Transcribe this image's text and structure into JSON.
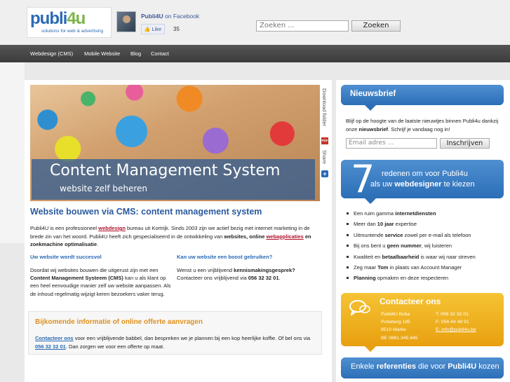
{
  "header": {
    "logo_text_a": "publi",
    "logo_text_b": "4u",
    "logo_tagline": "solutions for web & advertising",
    "fb_name": "Publi4U",
    "fb_on": "on Facebook",
    "fb_like_label": "Like",
    "fb_like_count": "35",
    "search_placeholder": "Zoeken ...",
    "search_button": "Zoeken"
  },
  "nav": {
    "items": [
      "Webdesign (CMS)",
      "Mobile Website",
      "Blog",
      "Contact"
    ]
  },
  "hero": {
    "title": "Content Management System",
    "subtitle": "website zelf beheren"
  },
  "tools": {
    "download": "Download folder",
    "pdf": "PDF",
    "share": "Share"
  },
  "main": {
    "title": "Website bouwen via CMS: content management system",
    "intro_1": "Publi4U is een professioneel ",
    "intro_link1": "webdesign",
    "intro_2": " bureau uit Kortrijk. Sinds 2003 zijn we actief bezig met internet marketing in de brede zin van het woord. Publi4U heeft zich gespecialiseerd in de ontwikkeling van ",
    "intro_b1": "websites, online ",
    "intro_link2": "webapplicaties",
    "intro_3": " en ",
    "intro_b2": "zoekmachine optimalisatie",
    "intro_4": ".",
    "col1_head": "Uw website wordt succesvol",
    "col1_a": "Doordat wij websites bouwen die uitgerust zijn met een ",
    "col1_b": "Content Management Systeem (CMS)",
    "col1_c": " kan u als klant op een heel eenvoudige manier zelf uw website aanpassen. Als de inhoud regelmatig wijzigt keren bezoekers vaker terug.",
    "col2_head": "Kan uw website een boost gebruiken?",
    "col2_a": "Wenst u een vrijblijvend ",
    "col2_b": "kennismakingsgesprek?",
    "col2_c": " Contacteer ons vrijblijvend via ",
    "col2_d": "056 32 32 01",
    "col2_e": "."
  },
  "offer": {
    "title": "Bijkomende informatie of online offerte aanvragen",
    "link": "Contacteer ons",
    "text_1": " voor een vrijblijvende babbel, dan bespreken we je plannen bij een kop heerlijke koffie. Of bel ons via ",
    "phone": "056 32 32 01",
    "text_2": ". Dan zorgen we voor een offerte op maat."
  },
  "newsletter": {
    "title": "Nieuwsbrief",
    "text_1": "Blijf op de hoogte van de laatste nieuwtjes binnen Publi4u dankzij onze ",
    "text_b": "nieuwsbrief",
    "text_2": ". Schrijf je vandaag nog in!",
    "placeholder": "Email adres ...",
    "button": "Inschrijven"
  },
  "reasons": {
    "number": "7",
    "line1": "redenen om voor Publi4u",
    "line2_a": "als uw ",
    "line2_b": "webdesigner",
    "line2_c": " te kiezen",
    "items": [
      {
        "pre": "Een ruim gamma ",
        "bold": "internetdiensten",
        "post": ""
      },
      {
        "pre": "Meer dan ",
        "bold": "10 jaar",
        "post": " expertise"
      },
      {
        "pre": "Uitmuntende ",
        "bold": "service",
        "post": " zowel per e-mail als telefoon"
      },
      {
        "pre": "Bij ons bent u ",
        "bold": "geen nummer",
        "post": ", wij luisteren"
      },
      {
        "pre": "Kwaliteit en ",
        "bold": "betaalbaarheid",
        "post": " is waar wij naar streven"
      },
      {
        "pre": "Zeg maar ",
        "bold": "Tom",
        "post": " in plaats van Account Manager"
      },
      {
        "pre": "",
        "bold": "Planning",
        "post": " opmaken en deze respecteren"
      }
    ]
  },
  "contact": {
    "title": "Contacteer ons",
    "company": "Publi4U Bvba",
    "street": "Potwberg 195",
    "city": "8510 Marke",
    "vat": "BE 0861.345.845",
    "tel": "T: 056 32 32 01",
    "fax": "F: 056 44 49 91",
    "email": "E: info@publi4u.be"
  },
  "refs": {
    "a": "Enkele ",
    "b": "referenties",
    "c": " die voor ",
    "d": "Publi4U",
    "e": " kozen"
  }
}
